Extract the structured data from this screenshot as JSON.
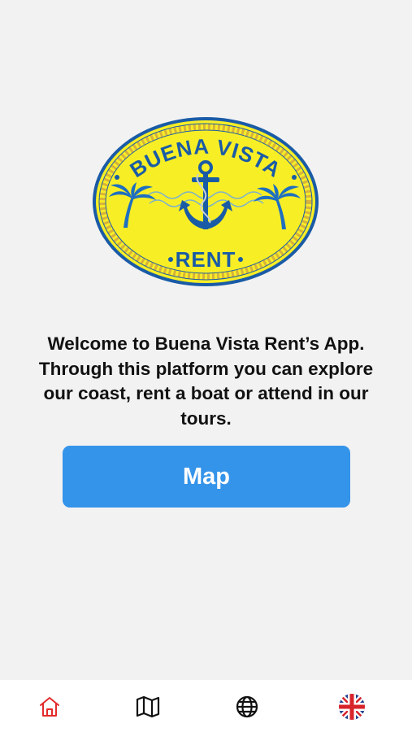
{
  "logo": {
    "text_top": "BUENA VISTA",
    "text_bottom": "RENT",
    "colors": {
      "fill": "#f7ee26",
      "border": "#1a5ba6",
      "rope": "#d9b23a",
      "accent": "#1e6fc0"
    }
  },
  "welcome": {
    "text": "Welcome to Buena Vista Rent’s App. Through this platform you can explore our coast, rent a boat or attend in our tours."
  },
  "map_button": {
    "label": "Map",
    "color": "#3494ea"
  },
  "tabbar": {
    "items": [
      {
        "id": "home",
        "icon": "home-icon",
        "active": true,
        "color": "#e32b2b"
      },
      {
        "id": "map",
        "icon": "map-icon",
        "active": false,
        "color": "#111111"
      },
      {
        "id": "globe",
        "icon": "globe-icon",
        "active": false,
        "color": "#111111"
      },
      {
        "id": "language",
        "icon": "uk-flag-icon",
        "active": false
      }
    ]
  }
}
